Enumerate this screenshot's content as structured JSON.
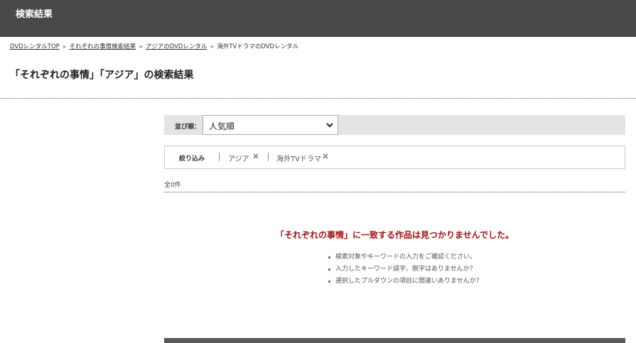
{
  "header": {
    "title": "検索結果"
  },
  "breadcrumb": {
    "items": [
      {
        "label": "DVDレンタルTOP",
        "link": true
      },
      {
        "label": "それぞれの事情検索結果",
        "link": true
      },
      {
        "label": "アジアのDVDレンタル",
        "link": true
      },
      {
        "label": "海外TVドラマのDVDレンタル",
        "link": false
      }
    ],
    "separator": ">"
  },
  "page_title": "「それぞれの事情」「アジア」の検索結果",
  "sort": {
    "label": "並び順：",
    "selected": "人気順"
  },
  "filter": {
    "label": "絞り込み",
    "chips": [
      {
        "label": "アジア",
        "icon": "close-icon"
      },
      {
        "label": "海外TVドラマ",
        "icon": "close-icon"
      }
    ]
  },
  "result_count": "全0件",
  "no_results": {
    "message": "「それぞれの事情」に一致する作品は見つかりませんでした。",
    "tips": [
      "検索対象やキーワードの入力をご確認ください。",
      "入力したキーワード誤字、脱字はありませんか？",
      "選択したプルダウンの項目に間違いありませんか？"
    ]
  },
  "colors": {
    "header_bg": "#484848",
    "error_text": "#a31515",
    "sort_bar_bg": "#e4e4e4"
  }
}
